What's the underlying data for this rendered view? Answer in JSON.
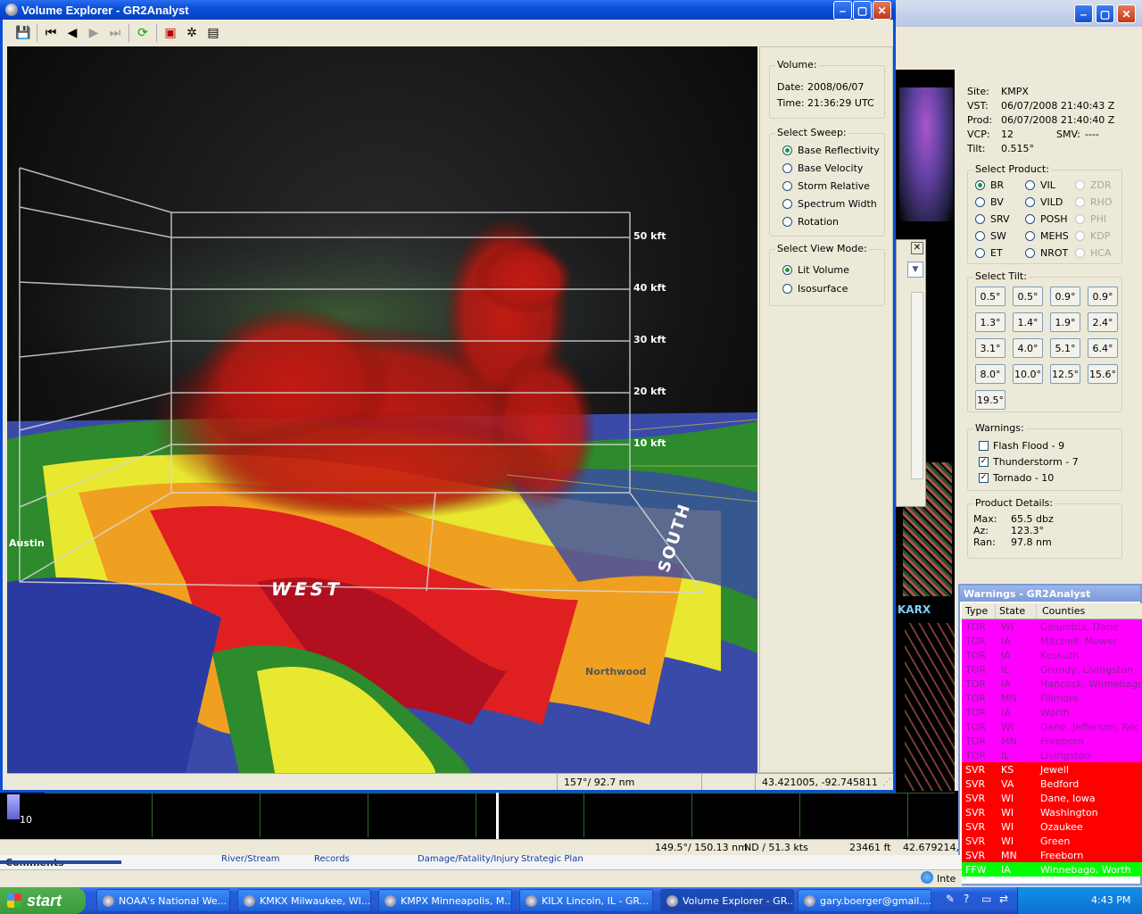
{
  "volume_explorer": {
    "title": "Volume Explorer - GR2Analyst",
    "volume": {
      "heading": "Volume:",
      "date_label": "Date:",
      "date": "2008/06/07",
      "time_label": "Time:",
      "time": "21:36:29 UTC"
    },
    "select_sweep": {
      "heading": "Select Sweep:",
      "options": [
        "Base Reflectivity",
        "Base Velocity",
        "Storm Relative",
        "Spectrum Width",
        "Rotation"
      ],
      "selected": "Base Reflectivity"
    },
    "select_view_mode": {
      "heading": "Select View Mode:",
      "options": [
        "Lit Volume",
        "Isosurface"
      ],
      "selected": "Lit Volume"
    },
    "altitude_labels": [
      "50 kft",
      "40 kft",
      "30 kft",
      "20 kft",
      "10 kft"
    ],
    "direction_labels": {
      "west": "WEST",
      "south": "SOUTH"
    },
    "place_labels": {
      "austin": "Austin",
      "northwood": "Northwood"
    },
    "status": {
      "az_range": "157°/ 92.7 nm",
      "latlon": "43.421005, -92.745811"
    }
  },
  "main_app": {
    "site_info": {
      "site_label": "Site:",
      "site": "KMPX",
      "vst_label": "VST:",
      "vst": "06/07/2008  21:40:43 Z",
      "prod_label": "Prod:",
      "prod": "06/07/2008  21:40:40 Z",
      "vcp_label": "VCP:",
      "vcp": "12",
      "smv_label": "SMV:",
      "smv": "----",
      "tilt_label": "Tilt:",
      "tilt": "0.515°"
    },
    "select_product": {
      "heading": "Select Product:",
      "col1": [
        "BR",
        "BV",
        "SRV",
        "SW",
        "ET"
      ],
      "col2": [
        "VIL",
        "VILD",
        "POSH",
        "MEHS",
        "NROT"
      ],
      "col3": [
        "ZDR",
        "RHO",
        "PHI",
        "KDP",
        "HCA"
      ],
      "selected": "BR"
    },
    "select_tilt": {
      "heading": "Select Tilt:",
      "tilts": [
        "0.5°",
        "0.5°",
        "0.9°",
        "0.9°",
        "1.3°",
        "1.4°",
        "1.9°",
        "2.4°",
        "3.1°",
        "4.0°",
        "5.1°",
        "6.4°",
        "8.0°",
        "10.0°",
        "12.5°",
        "15.6°",
        "19.5°"
      ]
    },
    "warnings": {
      "heading": "Warnings:",
      "items": [
        {
          "label": "Flash Flood - 9",
          "checked": false
        },
        {
          "label": "Thunderstorm - 7",
          "checked": true
        },
        {
          "label": "Tornado - 10",
          "checked": true
        }
      ]
    },
    "product_details": {
      "heading": "Product Details:",
      "max_label": "Max:",
      "max": "65.5 dbz",
      "az_label": "Az:",
      "az": "123.3°",
      "ran_label": "Ran:",
      "ran": "97.8 nm"
    },
    "bottom_status": {
      "az_range": "149.5°/ 150.13 nm",
      "nd": "ND / 51.3 kts",
      "height": "23461 ft",
      "lat": "42.679214,"
    },
    "radar_label_karx": "KARX",
    "colorbar_label": "10"
  },
  "warnings_window": {
    "title": "Warnings - GR2Analyst",
    "headers": [
      "Type",
      "State",
      "Counties"
    ],
    "rows": [
      {
        "type": "TOR",
        "state": "WI",
        "counties": "Columbia, Dane"
      },
      {
        "type": "TOR",
        "state": "IA",
        "counties": "Mitchell, Mower"
      },
      {
        "type": "TOR",
        "state": "IA",
        "counties": "Kossuth"
      },
      {
        "type": "TOR",
        "state": "IL",
        "counties": "Grundy, Livingston"
      },
      {
        "type": "TOR",
        "state": "IA",
        "counties": "Hancock, Winnebago"
      },
      {
        "type": "TOR",
        "state": "MN",
        "counties": "Fillmore"
      },
      {
        "type": "TOR",
        "state": "IA",
        "counties": "Worth"
      },
      {
        "type": "TOR",
        "state": "WI",
        "counties": "Dane, Jefferson, Roc"
      },
      {
        "type": "TOR",
        "state": "MN",
        "counties": "Freeborn"
      },
      {
        "type": "TOR",
        "state": "IL",
        "counties": "Livingston"
      },
      {
        "type": "SVR",
        "state": "KS",
        "counties": "Jewell"
      },
      {
        "type": "SVR",
        "state": "VA",
        "counties": "Bedford"
      },
      {
        "type": "SVR",
        "state": "WI",
        "counties": "Dane, Iowa"
      },
      {
        "type": "SVR",
        "state": "WI",
        "counties": "Washington"
      },
      {
        "type": "SVR",
        "state": "WI",
        "counties": "Ozaukee"
      },
      {
        "type": "SVR",
        "state": "WI",
        "counties": "Green"
      },
      {
        "type": "SVR",
        "state": "MN",
        "counties": "Freeborn"
      },
      {
        "type": "FFW",
        "state": "IA",
        "counties": "Winnebago, Worth"
      }
    ],
    "colors": {
      "TOR": "#ff00ff",
      "SVR": "#ff0000",
      "FFW": "#00ff00"
    }
  },
  "background_browser": {
    "comments": "Comments",
    "links": [
      "River/Stream",
      "Records",
      "Damage/Fatality/Injury",
      "Strategic Plan"
    ],
    "tray_text": "Inte"
  },
  "taskbar": {
    "start": "start",
    "items": [
      "NOAA's National We...",
      "KMKX Milwaukee, WI...",
      "KMPX Minneapolis, M...",
      "KILX Lincoln, IL - GR...",
      "Volume Explorer - GR...",
      "gary.boerger@gmail...."
    ],
    "active": "Volume Explorer - GR...",
    "clock": "4:43 PM"
  }
}
